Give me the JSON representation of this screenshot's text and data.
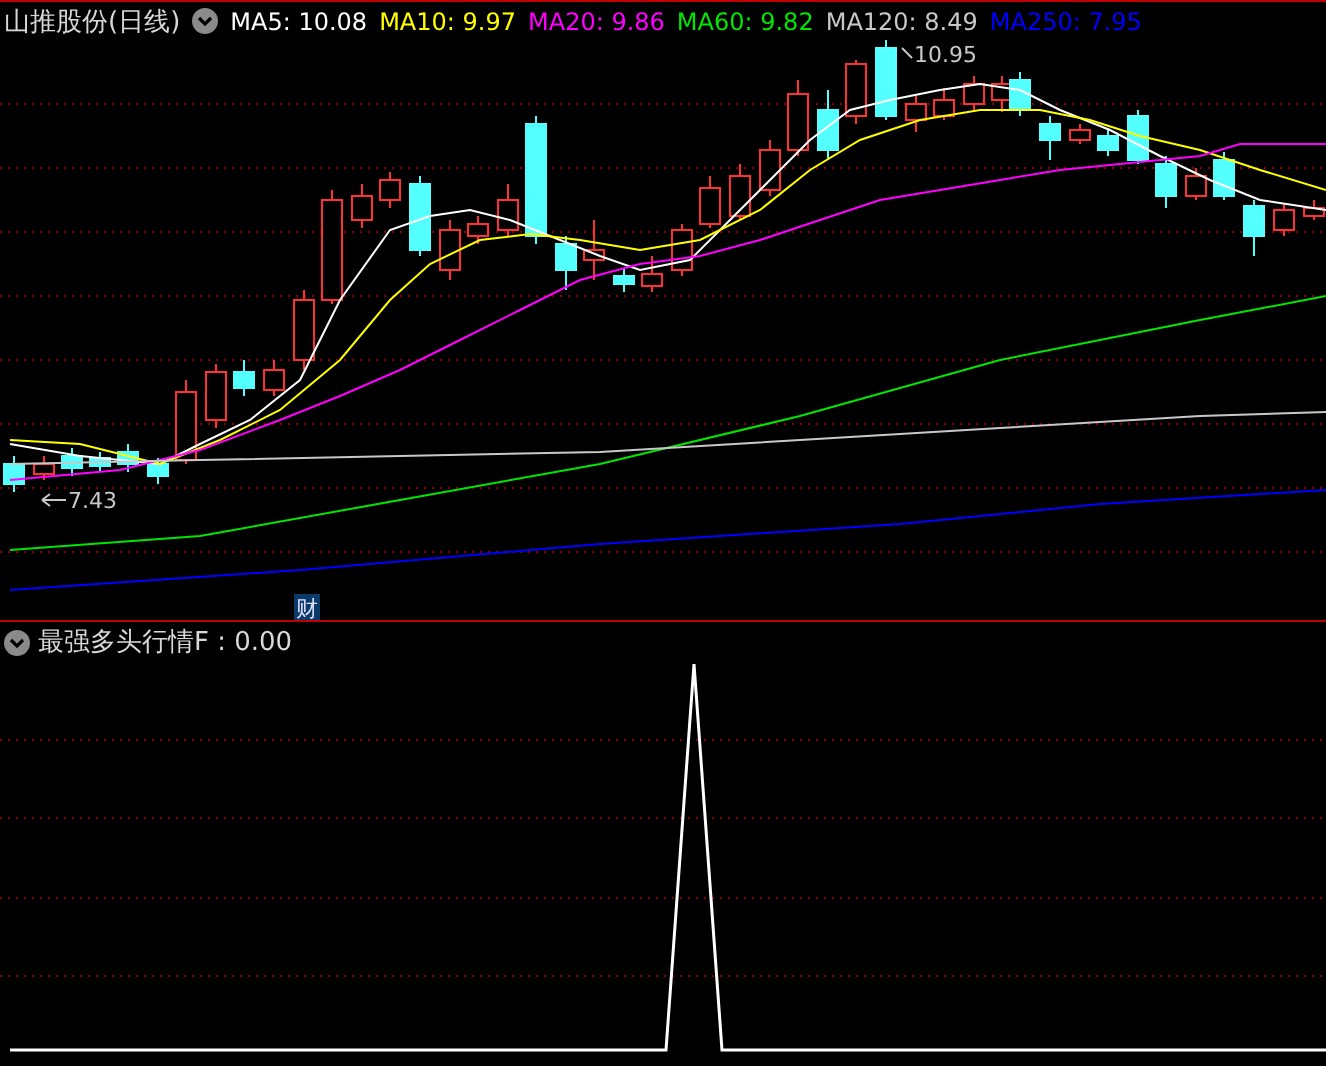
{
  "main_panel": {
    "title": "山推股份(日线)",
    "indicators": [
      {
        "text": "MA5: 10.08",
        "color": "#ffffff"
      },
      {
        "text": "MA10: 9.97",
        "color": "#ffff00"
      },
      {
        "text": "MA20: 9.86",
        "color": "#ff00ff"
      },
      {
        "text": "MA60: 9.82",
        "color": "#00e600"
      },
      {
        "text": "MA120: 8.49",
        "color": "#c8c8c8"
      },
      {
        "text": "MA250: 7.95",
        "color": "#0000ff"
      }
    ],
    "high_label": "10.95",
    "low_label": "7.43",
    "badge": "财"
  },
  "sub_panel": {
    "title": "最强多头行情F : 0.00"
  }
}
